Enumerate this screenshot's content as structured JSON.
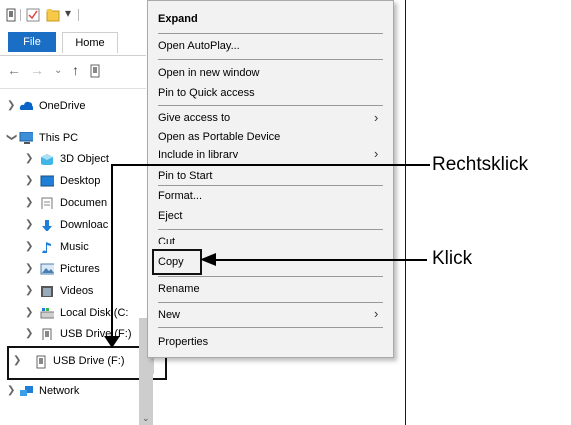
{
  "titlebar": {
    "icons": [
      "drive-icon",
      "checkbox-icon",
      "folder-icon",
      "dropdown-arrow-icon"
    ]
  },
  "ribbon": {
    "tabs": [
      {
        "label": "File",
        "active": true
      },
      {
        "label": "Home",
        "active": false
      }
    ]
  },
  "navbar": {
    "back_icon": "back-arrow-icon",
    "forward_icon": "forward-arrow-icon",
    "recent_icon": "chevron-down-icon",
    "up_icon": "up-arrow-icon"
  },
  "tree": {
    "items": [
      {
        "label": "OneDrive",
        "icon": "cloud-icon",
        "expanded": false
      },
      {
        "label": "This PC",
        "icon": "computer-icon",
        "expanded": true
      },
      {
        "label": "3D Object",
        "icon": "cube-icon"
      },
      {
        "label": "Desktop",
        "icon": "desktop-icon"
      },
      {
        "label": "Documen",
        "icon": "document-icon"
      },
      {
        "label": "Downloac",
        "icon": "download-icon"
      },
      {
        "label": "Music",
        "icon": "music-icon"
      },
      {
        "label": "Pictures",
        "icon": "pictures-icon"
      },
      {
        "label": "Videos",
        "icon": "videos-icon"
      },
      {
        "label": "Local Disk (C:",
        "icon": "disk-icon"
      },
      {
        "label": "USB Drive (F:)",
        "icon": "usb-drive-icon"
      },
      {
        "label": "USB Drive (F:)",
        "icon": "usb-drive-icon",
        "selected": true
      },
      {
        "label": "Network",
        "icon": "network-icon"
      }
    ]
  },
  "context_menu": {
    "items": [
      {
        "label": "Expand",
        "bold": true
      },
      {
        "label": "Open AutoPlay..."
      },
      {
        "label": "Open in new window"
      },
      {
        "label": "Pin to Quick access"
      },
      {
        "label": "Give access to",
        "submenu": true
      },
      {
        "label": "Open as Portable Device"
      },
      {
        "label": "Include in library",
        "submenu": true
      },
      {
        "label": "Pin to Start"
      },
      {
        "label": "Format..."
      },
      {
        "label": "Eject"
      },
      {
        "label": "Cut"
      },
      {
        "label": "Copy",
        "highlighted": true
      },
      {
        "label": "Rename"
      },
      {
        "label": "New",
        "submenu": true
      },
      {
        "label": "Properties"
      }
    ]
  },
  "callouts": {
    "right_click": "Rechtsklick",
    "click": "Klick"
  },
  "colors": {
    "file_tab": "#1a6fc4",
    "menu_bg": "#f2f2f2"
  }
}
